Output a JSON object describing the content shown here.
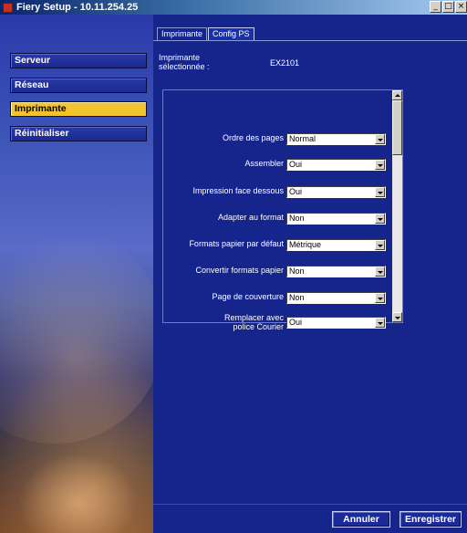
{
  "window": {
    "title": "Fiery Setup - 10.11.254.25",
    "controls": {
      "minimize": "_",
      "maximize": "□",
      "close": "×"
    }
  },
  "sidebar": {
    "items": [
      {
        "label": "Serveur"
      },
      {
        "label": "Réseau"
      },
      {
        "label": "Imprimante",
        "active": true
      },
      {
        "label": "Réinitialiser"
      }
    ]
  },
  "tabs": [
    {
      "label": "Imprimante"
    },
    {
      "label": "Config PS",
      "active": true
    }
  ],
  "printer": {
    "label": "Imprimante sélectionnée :",
    "value": "EX2101"
  },
  "settings": [
    {
      "label": "Ordre des pages",
      "value": "Normal"
    },
    {
      "label": "Assembler",
      "value": "Oui"
    },
    {
      "label": "Impression face dessous",
      "value": "Oui"
    },
    {
      "label": "Adapter au format",
      "value": "Non"
    },
    {
      "label": "Formats papier par défaut",
      "value": "Métrique"
    },
    {
      "label": "Convertir formats papier",
      "value": "Non"
    },
    {
      "label": "Page de couverture",
      "value": "Non"
    },
    {
      "label": "Remplacer avec police Courier",
      "value": "Oui"
    }
  ],
  "actions": {
    "cancel": "Annuler",
    "save": "Enregistrer"
  },
  "colors": {
    "background": "#15258c",
    "active_nav": "#f2c430"
  }
}
